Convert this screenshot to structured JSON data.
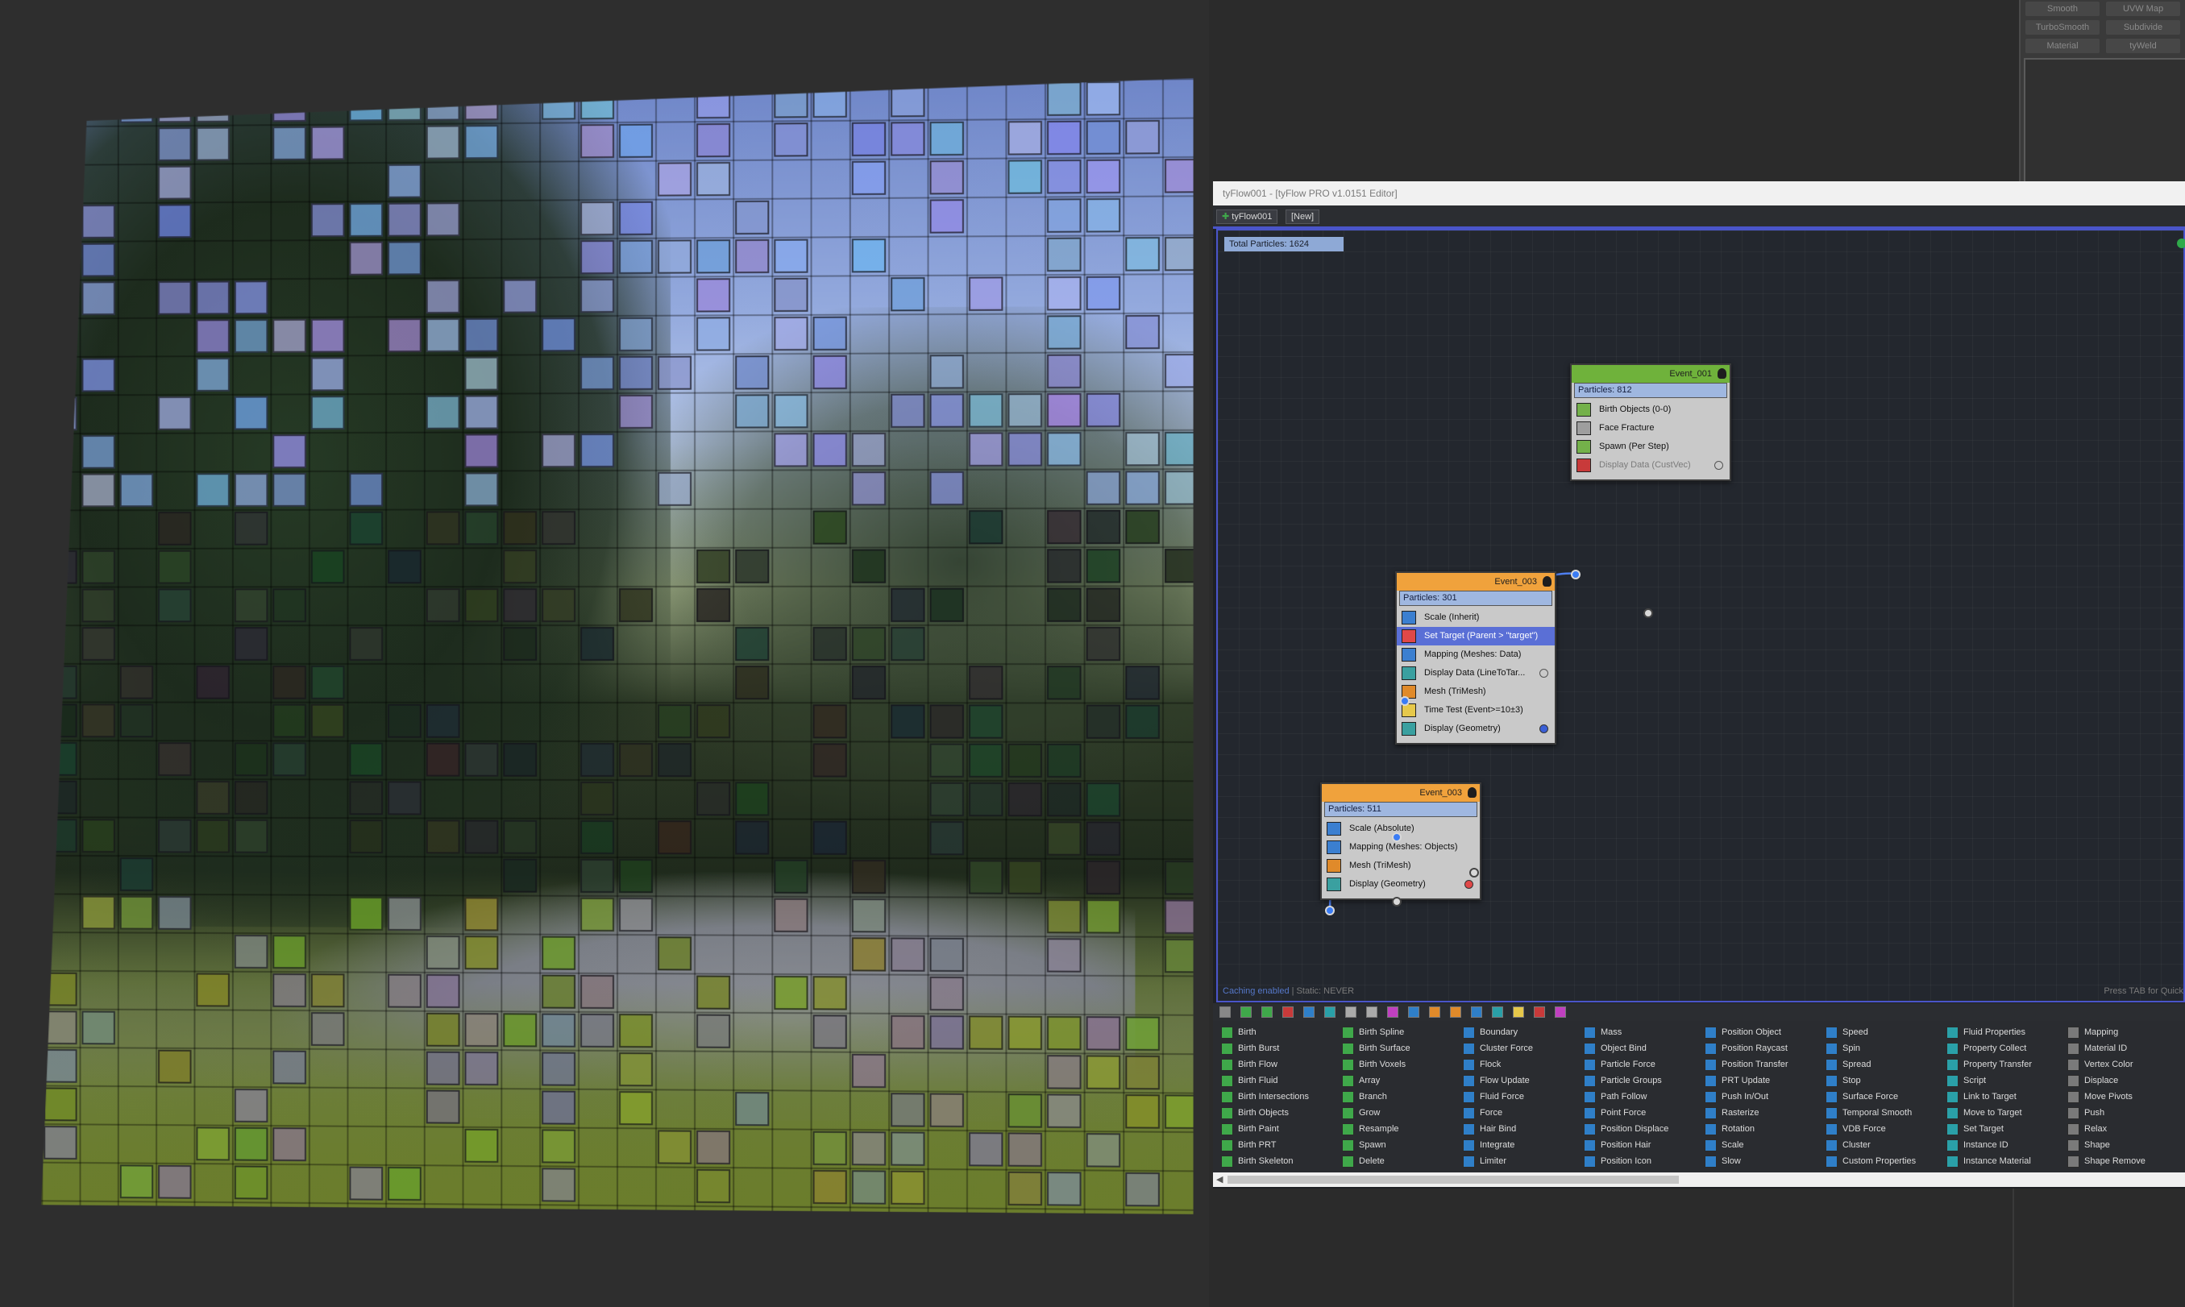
{
  "rollout": {
    "buttons": [
      [
        "Smooth",
        "UVW Map"
      ],
      [
        "TurboSmooth",
        "Subdivide"
      ],
      [
        "Material",
        "tyWeld"
      ]
    ]
  },
  "editor": {
    "title": "tyFlow001 - [tyFlow PRO v1.0151 Editor]",
    "tabs": [
      "tyFlow001",
      "[New]"
    ],
    "total_particles": "Total Particles: 1624",
    "caching": "Caching enabled",
    "static": " | Static: NEVER",
    "press_tab": "Press TAB for Quick",
    "colors": {
      "accent": "#4a55c9",
      "event_green": "#6fb23b",
      "event_orange": "#f0a23c",
      "selected_op": "#5a6fd6"
    }
  },
  "nodes": [
    {
      "title": "Event_001",
      "particles": "Particles: 812",
      "color": "#6fb23b",
      "ops": [
        {
          "label": "Birth Objects (0-0)",
          "icon": "birth-objects-icon",
          "color": "#74b14a"
        },
        {
          "label": "Face Fracture",
          "icon": "face-fracture-icon",
          "color": "#9e9e9e"
        },
        {
          "label": "Spawn (Per Step)",
          "icon": "spawn-icon",
          "color": "#74b14a"
        },
        {
          "label": "Display Data (CustVec)",
          "icon": "display-data-icon",
          "color": "#c83a3a",
          "dim": true,
          "dot": "#c9c9c9"
        }
      ]
    },
    {
      "title": "Event_003",
      "particles": "Particles: 301",
      "color": "#f0a23c",
      "ops": [
        {
          "label": "Scale (Inherit)",
          "icon": "scale-icon",
          "color": "#3b7fd0"
        },
        {
          "label": "Set Target (Parent > \"target\")",
          "icon": "set-target-icon",
          "color": "#e04848",
          "selected": true
        },
        {
          "label": "Mapping (Meshes: Data)",
          "icon": "mapping-icon",
          "color": "#3b7fd0"
        },
        {
          "label": "Display Data (LineToTar...",
          "icon": "display-data-icon",
          "color": "#3aa0a0",
          "dot": "#c9c9c9"
        },
        {
          "label": "Mesh (TriMesh)",
          "icon": "mesh-icon",
          "color": "#e08a2a"
        },
        {
          "label": "Time Test (Event>=10±3)",
          "icon": "time-test-icon",
          "color": "#e6c84a"
        },
        {
          "label": "Display (Geometry)",
          "icon": "display-icon",
          "color": "#3aa0a0",
          "dot": "#3a5fd6"
        }
      ]
    },
    {
      "title": "Event_003",
      "particles": "Particles: 511",
      "color": "#f0a23c",
      "ops": [
        {
          "label": "Scale (Absolute)",
          "icon": "scale-icon",
          "color": "#3b7fd0"
        },
        {
          "label": "Mapping (Meshes: Objects)",
          "icon": "mapping-icon",
          "color": "#3b7fd0"
        },
        {
          "label": "Mesh (TriMesh)",
          "icon": "mesh-icon",
          "color": "#e08a2a"
        },
        {
          "label": "Display (Geometry)",
          "icon": "display-icon",
          "color": "#3aa0a0",
          "dot": "#e04848"
        }
      ]
    }
  ],
  "depot": [
    {
      "color": "#3fa84a",
      "items": [
        "Birth",
        "Birth Burst",
        "Birth Flow",
        "Birth Fluid",
        "Birth Intersections",
        "Birth Objects",
        "Birth Paint",
        "Birth PRT",
        "Birth Skeleton"
      ]
    },
    {
      "color": "#3fa84a",
      "items": [
        "Birth Spline",
        "Birth Surface",
        "Birth Voxels",
        "Array",
        "Branch",
        "Grow",
        "Resample",
        "Spawn",
        "Delete"
      ]
    },
    {
      "color": "#2f7fc8",
      "items": [
        "Boundary",
        "Cluster Force",
        "Flock",
        "Flow Update",
        "Fluid Force",
        "Force",
        "Hair Bind",
        "Integrate",
        "Limiter"
      ]
    },
    {
      "color": "#2f7fc8",
      "items": [
        "Mass",
        "Object Bind",
        "Particle Force",
        "Particle Groups",
        "Path Follow",
        "Point Force",
        "Position Displace",
        "Position Hair",
        "Position Icon"
      ]
    },
    {
      "color": "#2f7fc8",
      "items": [
        "Position Object",
        "Position Raycast",
        "Position Transfer",
        "PRT Update",
        "Push In/Out",
        "Rasterize",
        "Rotation",
        "Scale",
        "Slow"
      ]
    },
    {
      "color": "#2f7fc8",
      "items": [
        "Speed",
        "Spin",
        "Spread",
        "Stop",
        "Surface Force",
        "Temporal Smooth",
        "VDB Force",
        "Cluster",
        "Custom Properties"
      ]
    },
    {
      "color": "#2aa0a8",
      "items": [
        "Fluid Properties",
        "Property Collect",
        "Property Transfer",
        "Script",
        "Link to Target",
        "Move to Target",
        "Set Target",
        "Instance ID",
        "Instance Material"
      ]
    },
    {
      "color": "#7a7a7a",
      "items": [
        "Mapping",
        "Material ID",
        "Vertex Color",
        "Displace",
        "Move Pivots",
        "Push",
        "Relax",
        "Shape",
        "Shape Remove"
      ]
    }
  ]
}
